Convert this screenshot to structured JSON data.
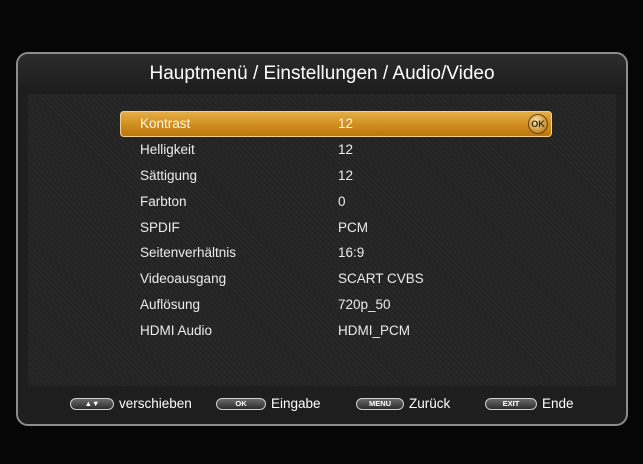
{
  "header": {
    "title": "Hauptmenü / Einstellungen / Audio/Video"
  },
  "menu": {
    "items": [
      {
        "label": "Kontrast",
        "value": "12"
      },
      {
        "label": "Helligkeit",
        "value": "12"
      },
      {
        "label": "Sättigung",
        "value": "12"
      },
      {
        "label": "Farbton",
        "value": "0"
      },
      {
        "label": "SPDIF",
        "value": "PCM"
      },
      {
        "label": "Seitenverhältnis",
        "value": "16:9"
      },
      {
        "label": "Videoausgang",
        "value": "SCART CVBS"
      },
      {
        "label": "Auflösung",
        "value": "720p_50"
      },
      {
        "label": "HDMI Audio",
        "value": "HDMI_PCM"
      }
    ],
    "selected_index": 0,
    "ok_badge": "OK",
    "highlight_color": "#d4921f"
  },
  "footer": {
    "hints": [
      {
        "key": "▲▼",
        "label": "verschieben"
      },
      {
        "key": "OK",
        "label": "Eingabe"
      },
      {
        "key": "MENU",
        "label": "Zurück"
      },
      {
        "key": "EXIT",
        "label": "Ende"
      }
    ]
  }
}
